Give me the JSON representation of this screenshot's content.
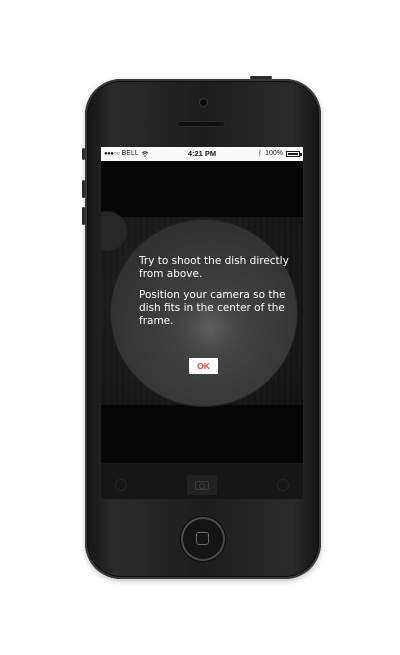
{
  "statusbar": {
    "signal": "●●●○○",
    "carrier": "BELL",
    "time": "4:21 PM",
    "battery": "100%",
    "icons": [
      "wifi-icon",
      "bluetooth-icon",
      "battery-icon"
    ]
  },
  "dialog": {
    "line1": "Try to shoot the dish directly from above.",
    "line2": "Position your camera so the dish fits in the center of the frame.",
    "ok_label": "OK"
  },
  "colors": {
    "accent": "#e8463c",
    "screen_bg": "#070707",
    "text": "#ffffff"
  }
}
